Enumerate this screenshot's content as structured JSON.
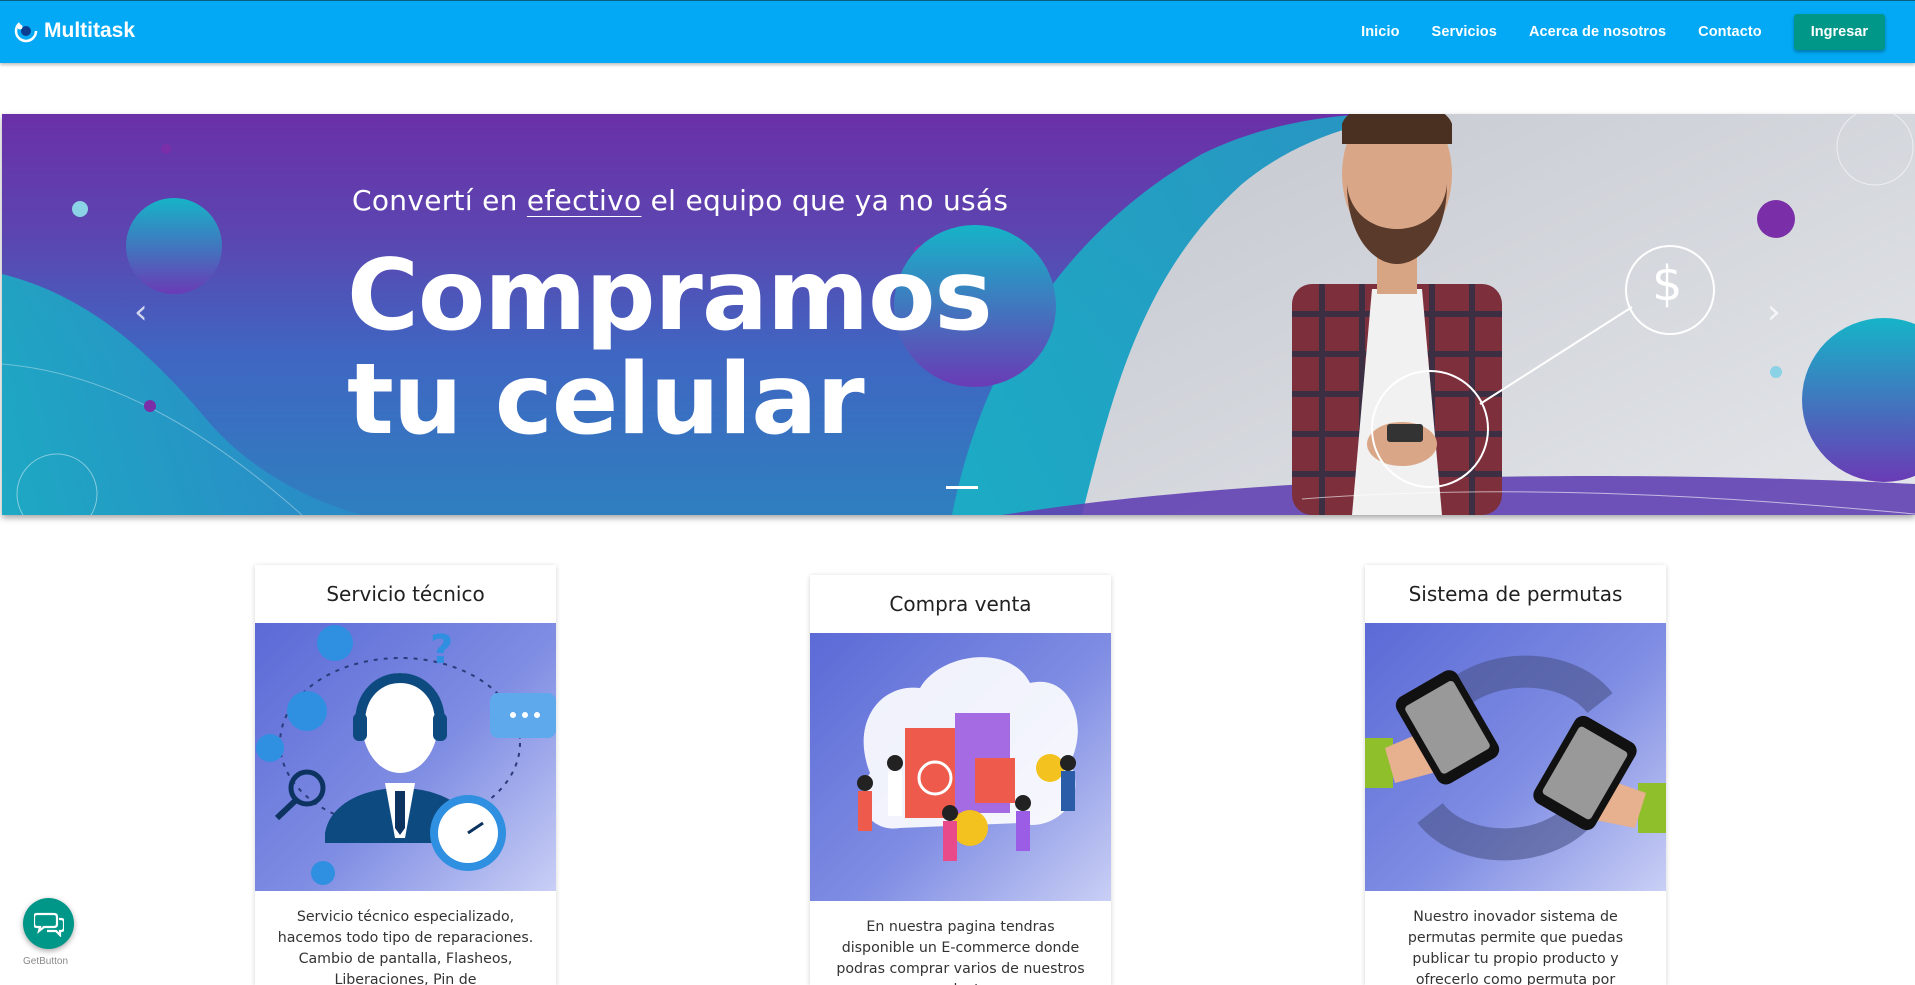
{
  "navbar": {
    "brand": "Multitask",
    "links": [
      "Inicio",
      "Servicios",
      "Acerca de nosotros",
      "Contacto"
    ],
    "login_button": "Ingresar",
    "color": "#03a9f4",
    "button_color": "#009688"
  },
  "hero": {
    "subtitle_pre": "Convertí en ",
    "subtitle_underlined": "efectivo",
    "subtitle_post": " el equipo que ya no usás",
    "headline_line1": "Compramos",
    "headline_line2": "tu celular",
    "prev_icon": "chevron-left-icon",
    "next_icon": "chevron-right-icon",
    "dollar_symbol": "$"
  },
  "cards": [
    {
      "title": "Servicio técnico",
      "text": "Servicio técnico especializado, hacemos todo tipo de reparaciones. Cambio de pantalla, Flasheos, Liberaciones, Pin de"
    },
    {
      "title": "Compra venta",
      "text": "En nuestra pagina tendras disponible un E-commerce donde podras comprar varios de nuestros productos"
    },
    {
      "title": "Sistema de permutas",
      "text": "Nuestro inovador sistema de permutas permite que puedas publicar tu propio producto y ofrecerlo como permuta por"
    }
  ],
  "chat": {
    "label": "GetButton",
    "icon": "chat-bubbles-icon"
  }
}
